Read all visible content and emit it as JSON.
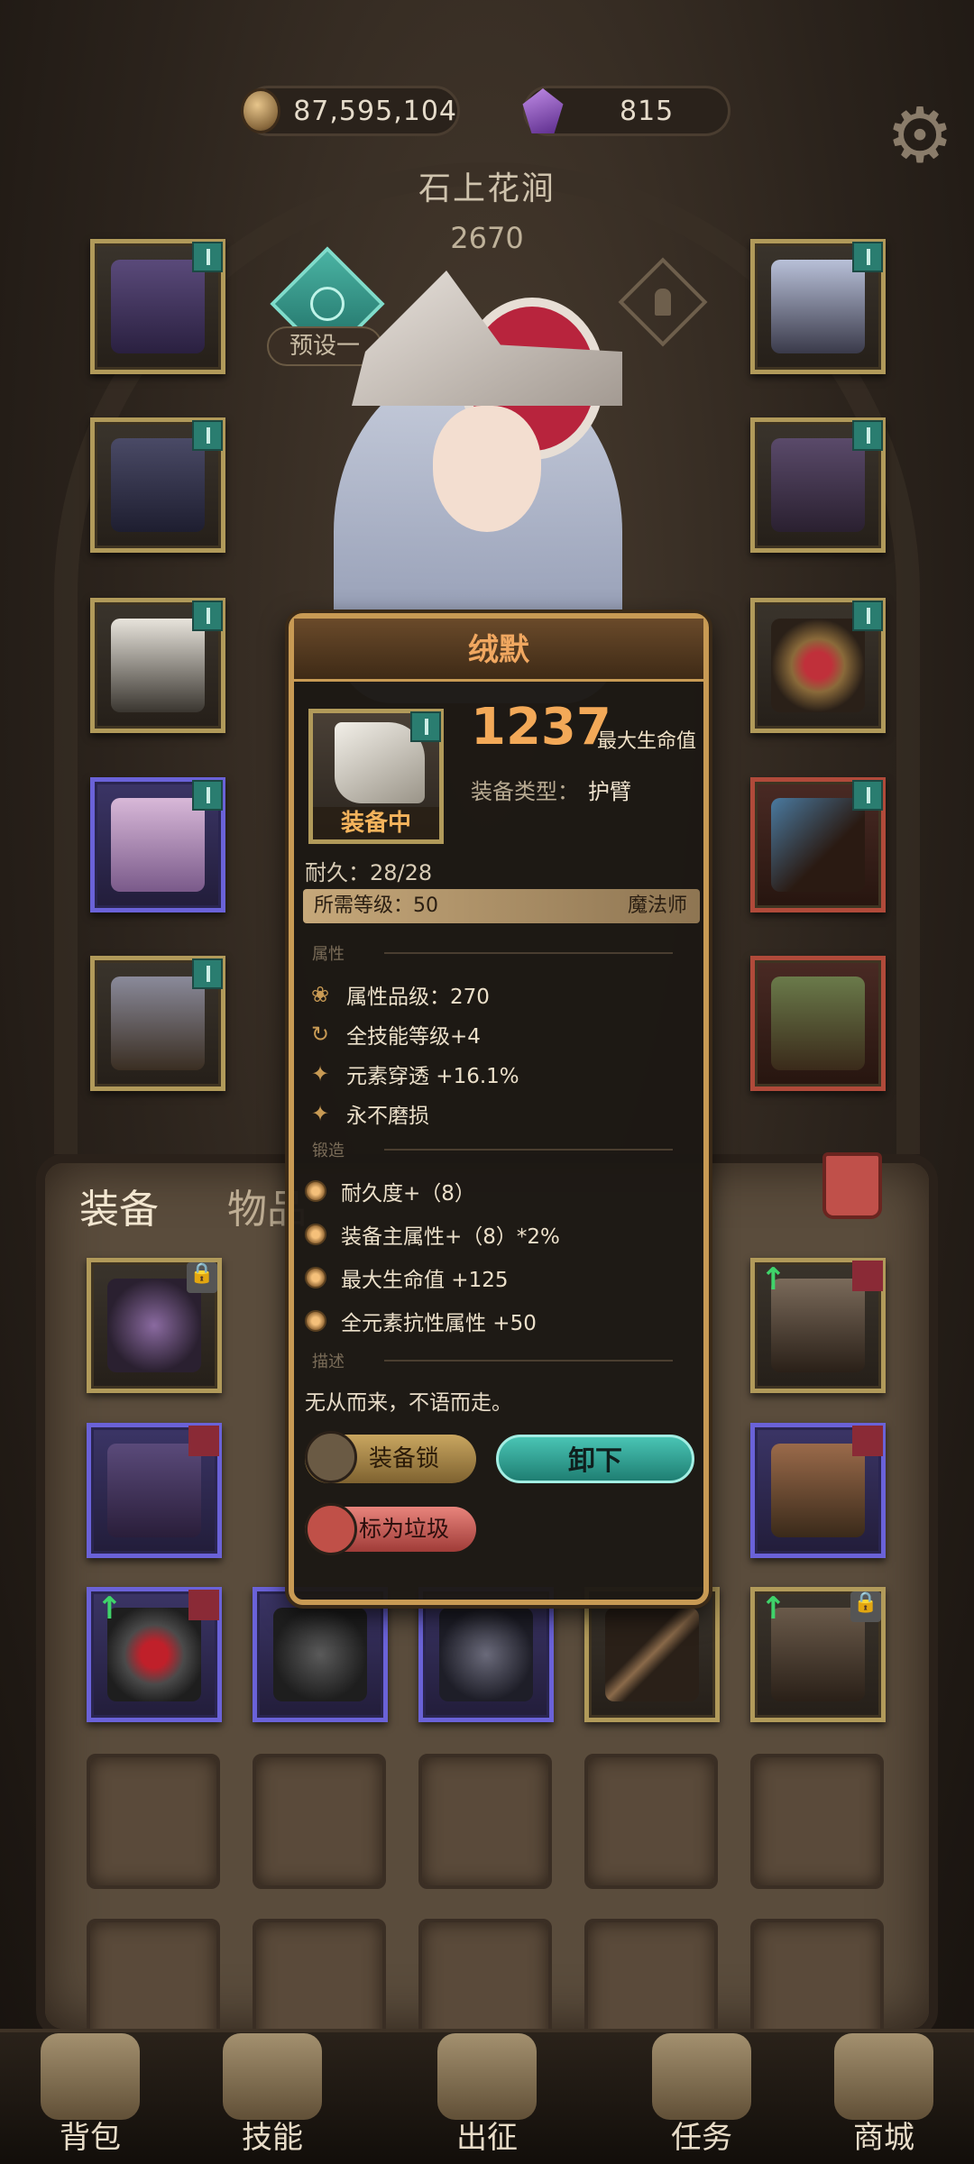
{
  "currency": {
    "gold": "87,595,104",
    "gems": "815"
  },
  "character": {
    "name": "石上花涧",
    "power": "2670"
  },
  "preset": {
    "label": "预设一"
  },
  "tabs": {
    "equip": "装备",
    "items": "物品"
  },
  "tooltip": {
    "title": "绒默",
    "main_value": "1237",
    "main_value_label": "最大生命值",
    "type_key": "装备类型：",
    "type_value": "护臂",
    "equipped": "装备中",
    "durability": "耐久：28/28",
    "required_level": "所需等级：50",
    "class": "魔法师",
    "section_attr": "属性",
    "attrs": [
      "属性品级：270",
      "全技能等级+4",
      "元素穿透 +16.1%",
      "永不磨损"
    ],
    "section_forge": "锻造",
    "forge": [
      "耐久度+（8）",
      "装备主属性+（8）*2%",
      "最大生命值 +125",
      "全元素抗性属性 +50"
    ],
    "section_desc": "描述",
    "description": "无从而来，不语而走。",
    "btn_lock": "装备锁",
    "btn_unequip": "卸下",
    "btn_junk": "标为垃圾"
  },
  "nav": [
    "背包",
    "技能",
    "出征",
    "任务",
    "商城"
  ],
  "colors": {
    "accent": "#f3a958",
    "teal": "#49c4b4",
    "frame": "#c89a54"
  }
}
